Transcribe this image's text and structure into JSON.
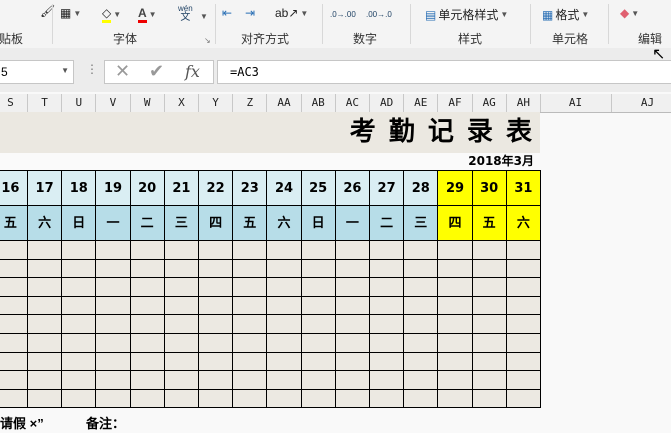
{
  "ribbon": {
    "groups": [
      {
        "label": "贴板"
      },
      {
        "label": "字体"
      },
      {
        "label": "对齐方式"
      },
      {
        "label": "数字"
      },
      {
        "label": "样式"
      },
      {
        "label": "单元格"
      },
      {
        "label": "编辑"
      }
    ],
    "cell_styles_label": "单元格样式",
    "format_label": "格式",
    "phonetic_top": "wén",
    "phonetic_bottom": "文",
    "font_color_glyph": "A",
    "fx_glyph": "fx",
    "inc_decimal": ".0→.00",
    "dec_decimal": ".00→.0"
  },
  "formula_bar": {
    "name_box": "5",
    "formula": "=AC3"
  },
  "columns": [
    "S",
    "T",
    "U",
    "V",
    "W",
    "X",
    "Y",
    "Z",
    "AA",
    "AB",
    "AC",
    "AD",
    "AE",
    "AF",
    "AG",
    "AH",
    "AI",
    "AJ"
  ],
  "sheet": {
    "title": "考 勤 记 录 表",
    "month": "2018年3月",
    "days": [
      "16",
      "17",
      "18",
      "19",
      "20",
      "21",
      "22",
      "23",
      "24",
      "25",
      "26",
      "27",
      "28",
      "29",
      "30",
      "31"
    ],
    "weekdays": [
      "五",
      "六",
      "日",
      "一",
      "二",
      "三",
      "四",
      "五",
      "六",
      "日",
      "一",
      "二",
      "三",
      "四",
      "五",
      "六"
    ],
    "highlight_days": [
      "29",
      "30",
      "31"
    ],
    "empty_rows": 9,
    "legend": "请假 ×”",
    "note_label": "备注："
  },
  "colors": {
    "day_bg": "#daeef3",
    "weekday_bg": "#b7dde8",
    "highlight": "#ffff00",
    "grid_bg": "#ece9e2",
    "title_bg": "#ebe8e1"
  }
}
